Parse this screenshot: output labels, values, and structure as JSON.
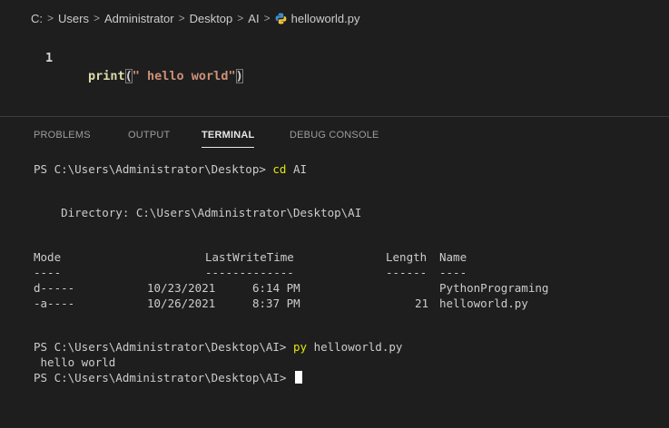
{
  "breadcrumb": {
    "items": [
      "C:",
      "Users",
      "Administrator",
      "Desktop",
      "AI",
      "helloworld.py"
    ],
    "separator": ">",
    "file_icon": "python-file-icon"
  },
  "editor": {
    "line_number": "1",
    "code": {
      "fn": "print",
      "open": "(",
      "string": "\" hello world\"",
      "close": ")"
    }
  },
  "panel": {
    "tabs": [
      {
        "label": "PROBLEMS",
        "active": false
      },
      {
        "label": "OUTPUT",
        "active": false
      },
      {
        "label": "TERMINAL",
        "active": true
      },
      {
        "label": "DEBUG CONSOLE",
        "active": false
      }
    ]
  },
  "terminal": {
    "prompt1": "PS C:\\Users\\Administrator\\Desktop> ",
    "cmd1_kw": "cd",
    "cmd1_arg": " AI",
    "directory_line": "    Directory: C:\\Users\\Administrator\\Desktop\\AI",
    "headers": {
      "mode": "Mode",
      "lastwrite": "LastWriteTime",
      "length": "Length",
      "name": "Name"
    },
    "underlines": {
      "mode": "----",
      "lastwrite": "-------------",
      "length": "------",
      "name": "----"
    },
    "rows": [
      {
        "mode": "d-----",
        "date": "10/23/2021",
        "time": "6:14 PM",
        "length": "",
        "name": "PythonPrograming"
      },
      {
        "mode": "-a----",
        "date": "10/26/2021",
        "time": "8:37 PM",
        "length": "21",
        "name": "helloworld.py"
      }
    ],
    "prompt2": "PS C:\\Users\\Administrator\\Desktop\\AI> ",
    "cmd2_kw": "py",
    "cmd2_arg": " helloworld.py",
    "output": " hello world",
    "prompt3": "PS C:\\Users\\Administrator\\Desktop\\AI> "
  },
  "colors": {
    "background": "#1e1e1e",
    "function": "#dcdcaa",
    "string": "#ce9178",
    "keyword": "#e5e510",
    "text": "#cccccc"
  }
}
